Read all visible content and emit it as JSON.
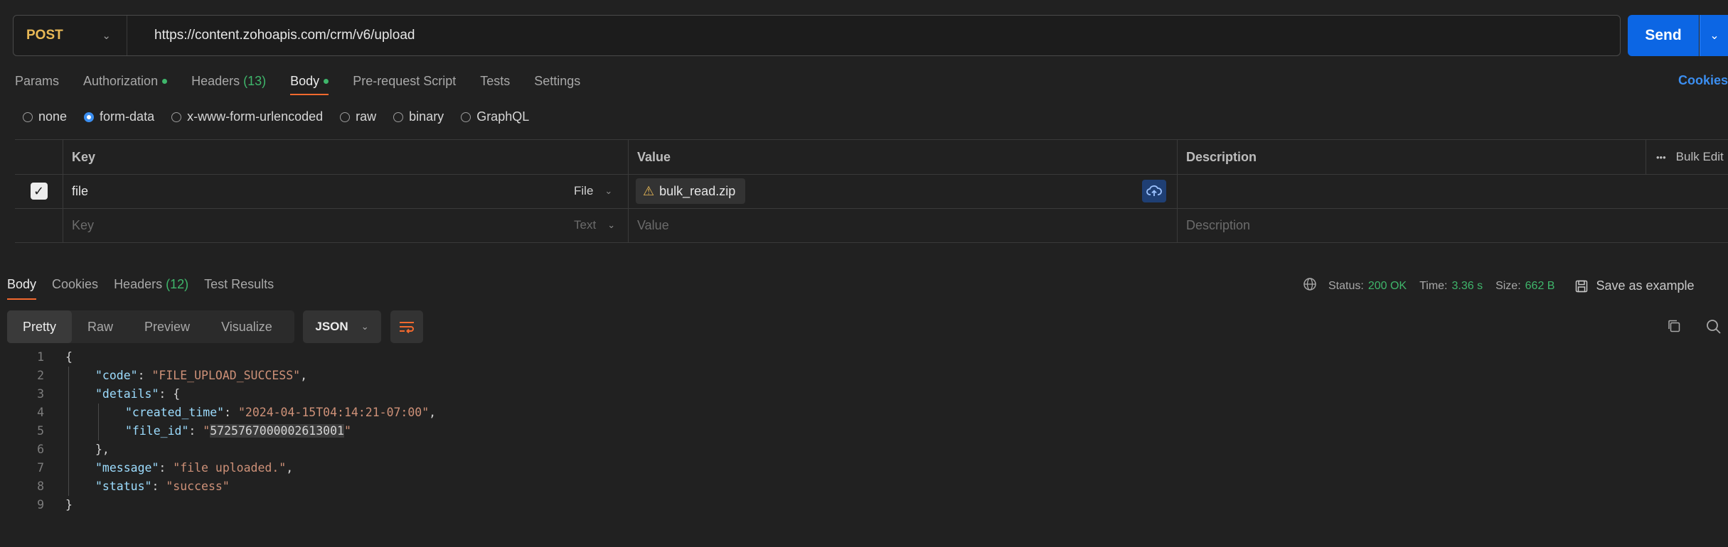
{
  "request": {
    "method": "POST",
    "url": "https://content.zohoapis.com/crm/v6/upload",
    "send_label": "Send"
  },
  "request_tabs": [
    {
      "label": "Params",
      "count": "",
      "dot": false,
      "active": false
    },
    {
      "label": "Authorization",
      "count": "",
      "dot": true,
      "active": false
    },
    {
      "label": "Headers",
      "count": "(13)",
      "dot": false,
      "active": false
    },
    {
      "label": "Body",
      "count": "",
      "dot": true,
      "active": true
    },
    {
      "label": "Pre-request Script",
      "count": "",
      "dot": false,
      "active": false
    },
    {
      "label": "Tests",
      "count": "",
      "dot": false,
      "active": false
    },
    {
      "label": "Settings",
      "count": "",
      "dot": false,
      "active": false
    }
  ],
  "cookies_link": "Cookies",
  "body_types": [
    {
      "label": "none",
      "selected": false
    },
    {
      "label": "form-data",
      "selected": true
    },
    {
      "label": "x-www-form-urlencoded",
      "selected": false
    },
    {
      "label": "raw",
      "selected": false
    },
    {
      "label": "binary",
      "selected": false
    },
    {
      "label": "GraphQL",
      "selected": false
    }
  ],
  "table": {
    "headers": {
      "key": "Key",
      "value": "Value",
      "description": "Description",
      "bulk_edit": "Bulk Edit",
      "more": "•••"
    },
    "row": {
      "key": "file",
      "type": "File",
      "value": "bulk_read.zip",
      "description": ""
    },
    "placeholder": {
      "key": "Key",
      "type": "Text",
      "value": "Value",
      "description": "Description"
    }
  },
  "response_tabs": [
    {
      "label": "Body",
      "count": "",
      "active": true
    },
    {
      "label": "Cookies",
      "count": "",
      "active": false
    },
    {
      "label": "Headers",
      "count": "(12)",
      "active": false
    },
    {
      "label": "Test Results",
      "count": "",
      "active": false
    }
  ],
  "response_meta": {
    "status_label": "Status:",
    "status_value": "200 OK",
    "time_label": "Time:",
    "time_value": "3.36 s",
    "size_label": "Size:",
    "size_value": "662 B",
    "save_example": "Save as example"
  },
  "views": [
    {
      "label": "Pretty",
      "active": true
    },
    {
      "label": "Raw",
      "active": false
    },
    {
      "label": "Preview",
      "active": false
    },
    {
      "label": "Visualize",
      "active": false
    }
  ],
  "format": "JSON",
  "code_lines": [
    {
      "n": "1",
      "indent": 0,
      "tokens": [
        [
          "p",
          "{"
        ]
      ]
    },
    {
      "n": "2",
      "indent": 1,
      "tokens": [
        [
          "k",
          "\"code\""
        ],
        [
          "p",
          ": "
        ],
        [
          "s",
          "\"FILE_UPLOAD_SUCCESS\""
        ],
        [
          "p",
          ","
        ]
      ]
    },
    {
      "n": "3",
      "indent": 1,
      "tokens": [
        [
          "k",
          "\"details\""
        ],
        [
          "p",
          ": {"
        ]
      ]
    },
    {
      "n": "4",
      "indent": 2,
      "tokens": [
        [
          "k",
          "\"created_time\""
        ],
        [
          "p",
          ": "
        ],
        [
          "s",
          "\"2024-04-15T04:14:21-07:00\""
        ],
        [
          "p",
          ","
        ]
      ]
    },
    {
      "n": "5",
      "indent": 2,
      "tokens": [
        [
          "k",
          "\"file_id\""
        ],
        [
          "p",
          ": "
        ],
        [
          "s",
          "\""
        ],
        [
          "sel",
          "5725767000002613001"
        ],
        [
          "s",
          "\""
        ]
      ]
    },
    {
      "n": "6",
      "indent": 1,
      "tokens": [
        [
          "p",
          "},"
        ]
      ]
    },
    {
      "n": "7",
      "indent": 1,
      "tokens": [
        [
          "k",
          "\"message\""
        ],
        [
          "p",
          ": "
        ],
        [
          "s",
          "\"file uploaded.\""
        ],
        [
          "p",
          ","
        ]
      ]
    },
    {
      "n": "8",
      "indent": 1,
      "tokens": [
        [
          "k",
          "\"status\""
        ],
        [
          "p",
          ": "
        ],
        [
          "s",
          "\"success\""
        ]
      ]
    },
    {
      "n": "9",
      "indent": 0,
      "tokens": [
        [
          "p",
          "}"
        ]
      ]
    }
  ]
}
